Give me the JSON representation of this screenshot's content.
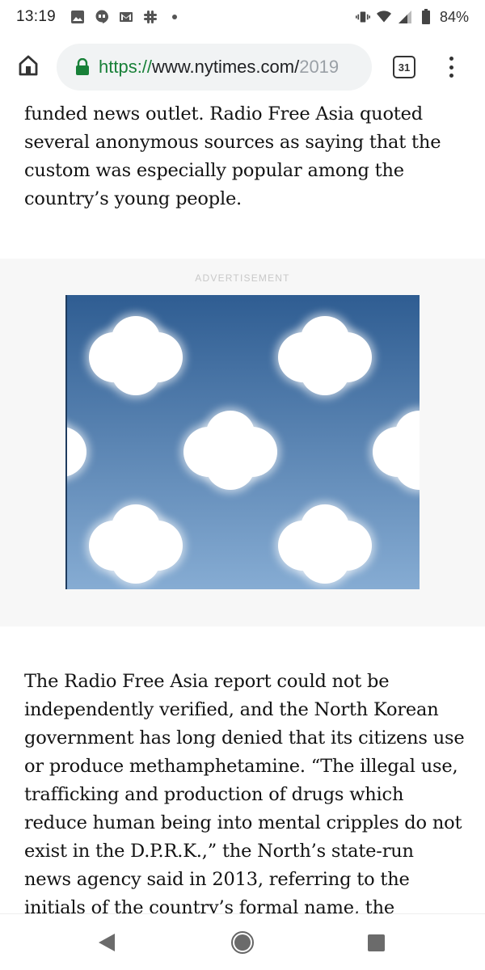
{
  "status_bar": {
    "time": "13:19",
    "left_icons": [
      "gallery-icon",
      "hangouts-icon",
      "gmail-icon",
      "slack-icon",
      "dot-icon"
    ],
    "right_icons": [
      "vibrate-icon",
      "wifi-icon",
      "signal-icon",
      "battery-icon"
    ],
    "battery": "84%"
  },
  "browser": {
    "url_scheme": "https://",
    "url_host": "www.nytimes.com/",
    "url_fade": "2019",
    "tab_count": "31"
  },
  "article": {
    "paragraph_1": "funded news outlet. Radio Free Asia quoted several anonymous sources as saying that the custom was especially popular among the country’s young people.",
    "paragraph_2": "The Radio Free Asia report could not be independently verified, and the North Korean government has long denied that its citizens use or produce methamphetamine. “The illegal use, trafficking and production of drugs which reduce human being into mental cripples do not exist in the D.P.R.K.,” the North’s state-run news agency said in 2013, referring to the initials of the country’s formal name, the Democratic People’s"
  },
  "ad": {
    "label": "ADVERTISEMENT",
    "colors": {
      "sky_top": "#2f5d92",
      "sky_bottom": "#86acd3",
      "cloud": "#ffffff"
    }
  },
  "nav": [
    "back-icon",
    "home-icon",
    "recents-icon"
  ],
  "colors": {
    "url_scheme": "#188038",
    "lock": "#188038",
    "text": "#121212"
  }
}
